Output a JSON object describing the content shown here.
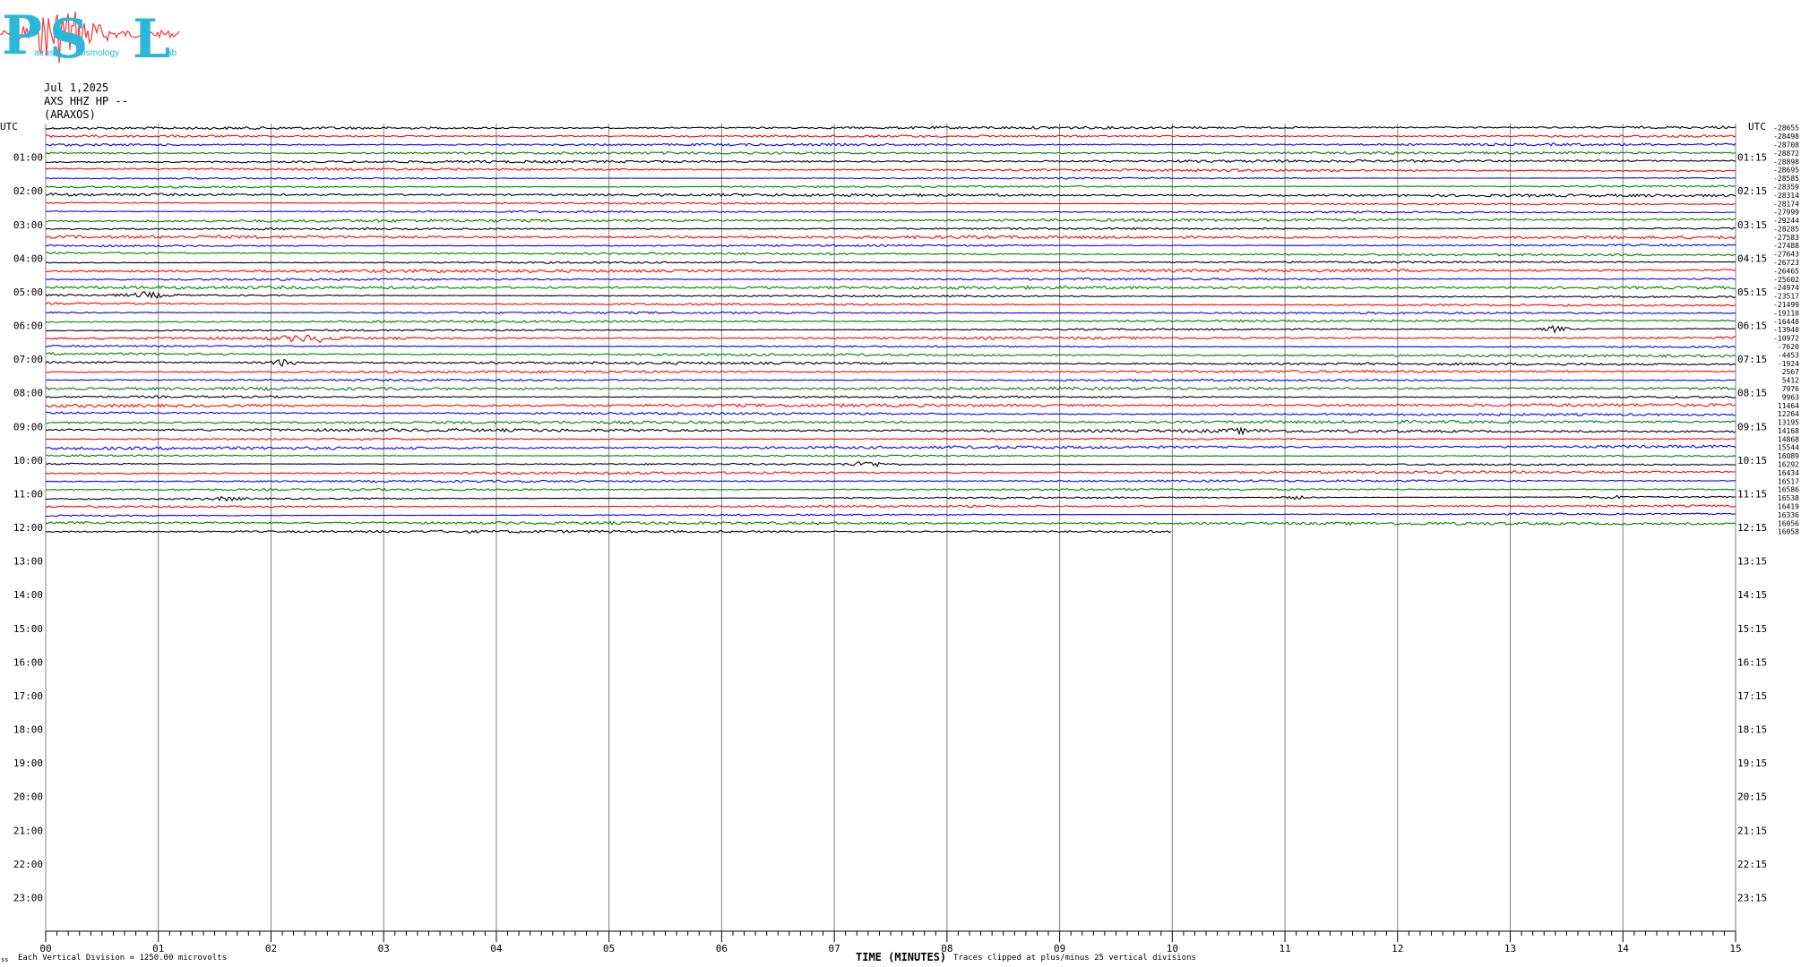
{
  "logo": {
    "letters": [
      "P",
      "S",
      "L"
    ],
    "small_text": [
      "atras",
      "eismology",
      "ab"
    ],
    "colors": {
      "letters": "#2bb8d8",
      "seismogram": "#ff3333"
    }
  },
  "header": {
    "date": "Jul 1,2025",
    "station": "AXS HHZ HP --",
    "location": "(ARAXOS)"
  },
  "footer": {
    "vertical_division": "Each Vertical Division = 1250.00 microvolts",
    "corner_mark": "ss",
    "time_label": "TIME (MINUTES)",
    "clip_note": "Traces clipped at plus/minus 25 vertical divisions"
  },
  "chart_data": {
    "type": "line",
    "title": "",
    "xlabel": "TIME (MINUTES)",
    "ylabel": "",
    "xlim": [
      0,
      15
    ],
    "x_ticks": [
      "00",
      "01",
      "02",
      "03",
      "04",
      "05",
      "06",
      "07",
      "08",
      "09",
      "10",
      "11",
      "12",
      "13",
      "14",
      "15"
    ],
    "left_label_top": "UTC",
    "right_label_top": "UTC",
    "left_hour_labels": [
      "01:00",
      "02:00",
      "03:00",
      "04:00",
      "05:00",
      "06:00",
      "07:00",
      "08:00",
      "09:00",
      "10:00",
      "11:00",
      "12:00",
      "13:00",
      "14:00",
      "15:00",
      "16:00",
      "17:00",
      "18:00",
      "19:00",
      "20:00",
      "21:00",
      "22:00",
      "23:00"
    ],
    "right_hour_labels": [
      "01:15",
      "02:15",
      "03:15",
      "04:15",
      "05:15",
      "06:15",
      "07:15",
      "08:15",
      "09:15",
      "10:15",
      "11:15",
      "12:15",
      "13:15",
      "14:15",
      "15:15",
      "16:15",
      "17:15",
      "18:15",
      "19:15",
      "20:15",
      "21:15",
      "22:15",
      "23:15"
    ],
    "trace_color_cycle": [
      "#000000",
      "#ff0000",
      "#0000ff",
      "#008000"
    ],
    "rows_per_hour": 4,
    "total_rows": 96,
    "recorded_rows": 49,
    "last_row_end_minute": 10,
    "trace_offsets": [
      -28655,
      -28498,
      -28708,
      -28872,
      -28898,
      -28695,
      -28585,
      -28359,
      -28314,
      -28174,
      -27999,
      -29244,
      -28285,
      -27583,
      -27488,
      -27643,
      -26723,
      -26465,
      -25602,
      -24974,
      -23517,
      -21499,
      -19110,
      -16448,
      -13940,
      -10972,
      -7620,
      -4453,
      -1924,
      2567,
      5412,
      7976,
      9963,
      11464,
      12264,
      13195,
      14168,
      14868,
      15544,
      16089,
      16292,
      16434,
      16517,
      16586,
      16538,
      16419,
      16336,
      16056,
      16058
    ],
    "events": [
      {
        "row": 20,
        "minute": 0.9,
        "amplitude": "moderate"
      },
      {
        "row": 25,
        "minute": 2.2,
        "amplitude": "small"
      },
      {
        "row": 25,
        "minute": 2.4,
        "amplitude": "moderate"
      },
      {
        "row": 28,
        "minute": 2.1,
        "amplitude": "moderate"
      },
      {
        "row": 24,
        "minute": 13.4,
        "amplitude": "moderate"
      },
      {
        "row": 36,
        "minute": 10.6,
        "amplitude": "small"
      },
      {
        "row": 40,
        "minute": 7.3,
        "amplitude": "moderate"
      },
      {
        "row": 44,
        "minute": 1.6,
        "amplitude": "small"
      },
      {
        "row": 44,
        "minute": 11.1,
        "amplitude": "small"
      },
      {
        "row": 44,
        "minute": 13.9,
        "amplitude": "small"
      }
    ]
  }
}
